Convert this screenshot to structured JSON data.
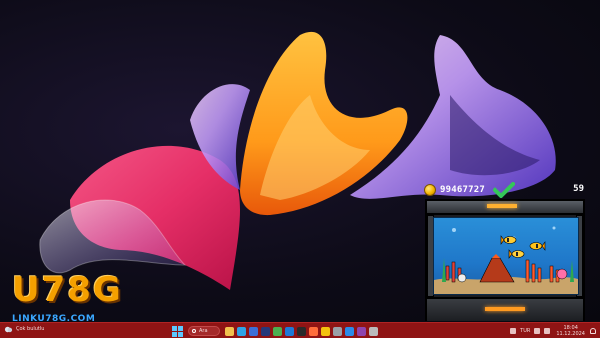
{
  "desktop": {
    "wallpaper": "abstract-ribbons",
    "colors": {
      "magenta": "#f0306a",
      "orange": "#ff9a1a",
      "violet": "#6a4bd8",
      "background": "#0d0b17"
    }
  },
  "aquarium_widget": {
    "coins": "99467727",
    "level": "59",
    "check_icon": "check-icon",
    "colors": {
      "water": "#2a8fd8",
      "frame": "#1b1d22",
      "light": "#ffb030"
    }
  },
  "logo": {
    "mark": "U78G",
    "domain": "LINKU78G.COM",
    "colors": {
      "primary": "#f5a000",
      "domain": "#3aa7ff"
    }
  },
  "taskbar": {
    "color": "#8f1414",
    "weather": {
      "icon": "weather-icon",
      "text": "Çok bulutlu"
    },
    "search": {
      "label": "Ara"
    },
    "apps": [
      {
        "name": "file-explorer-icon",
        "color": "#f2c14e"
      },
      {
        "name": "edge-icon",
        "color": "#2fa3e6"
      },
      {
        "name": "store-icon",
        "color": "#3b6fd8"
      },
      {
        "name": "photoshop-icon",
        "color": "#26387a"
      },
      {
        "name": "xbox-icon",
        "color": "#4caf50"
      },
      {
        "name": "outlook-icon",
        "color": "#1e79d6"
      },
      {
        "name": "terminal-icon",
        "color": "#2a2a2a"
      },
      {
        "name": "maps-icon",
        "color": "#ff6d3b"
      },
      {
        "name": "chrome-icon",
        "color": "#f4c20d"
      },
      {
        "name": "settings-icon",
        "color": "#9aa0a6"
      },
      {
        "name": "vscode-icon",
        "color": "#2a8be8"
      },
      {
        "name": "app-purple-icon",
        "color": "#8e44ad"
      },
      {
        "name": "gear-icon",
        "color": "#bbbbbb"
      }
    ],
    "tray": {
      "lang": "TUR",
      "time": "18:04",
      "date": "11.12.2024"
    }
  }
}
